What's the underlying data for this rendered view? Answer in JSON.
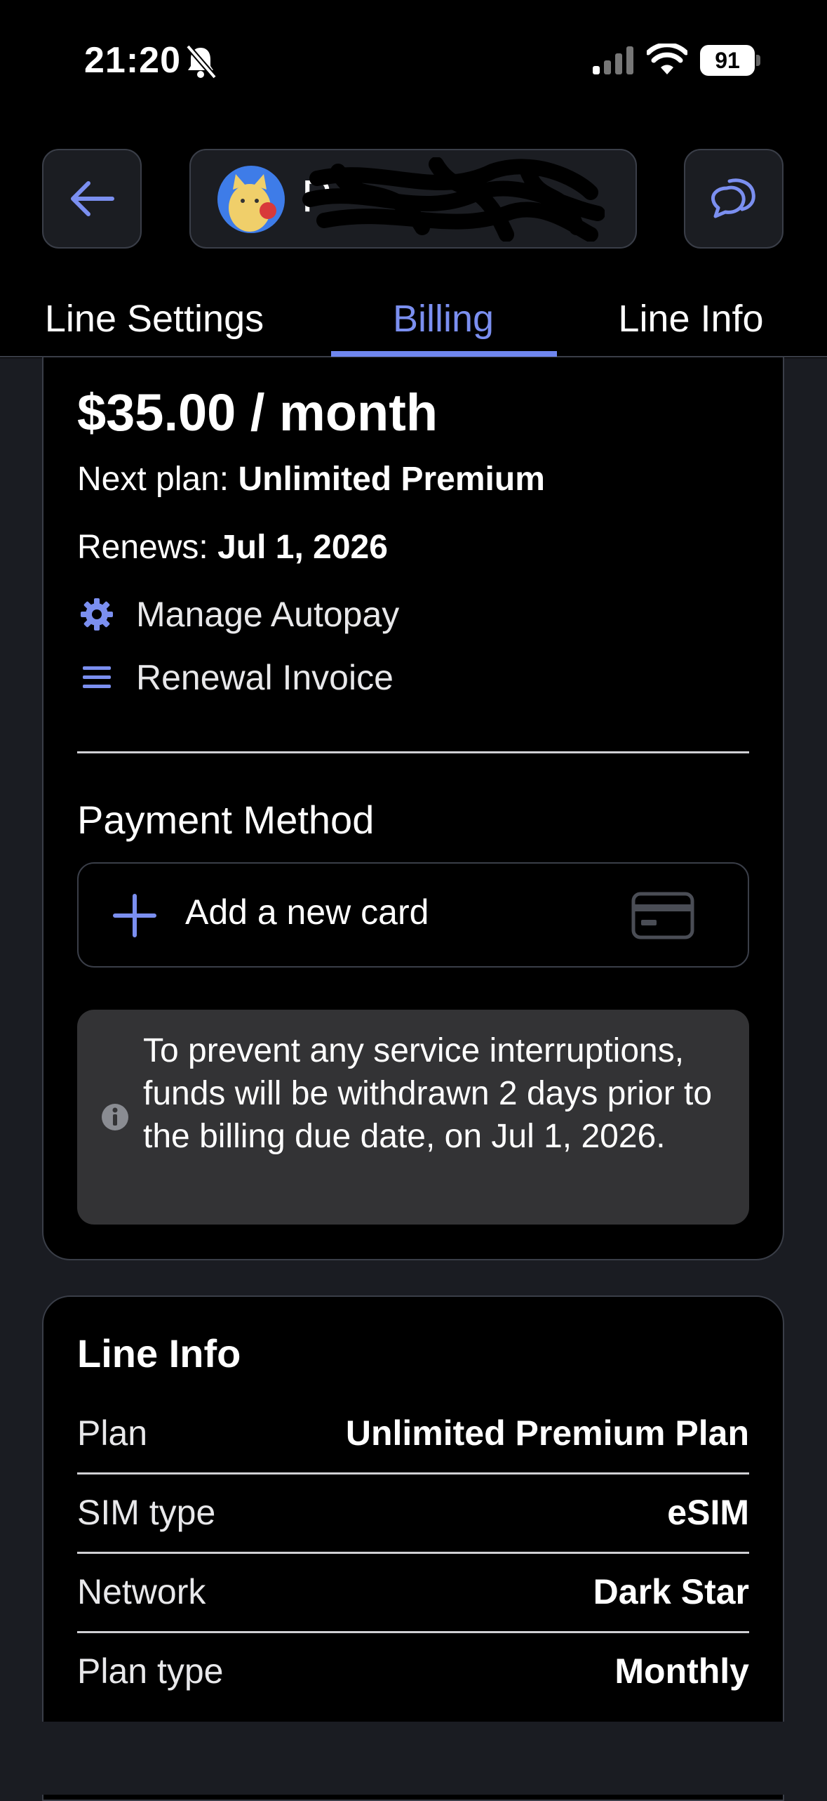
{
  "status_bar": {
    "time": "21:20",
    "battery": "91"
  },
  "header": {
    "account_name": "P"
  },
  "tabs": [
    {
      "label": "Line Settings",
      "active": false
    },
    {
      "label": "Billing",
      "active": true
    },
    {
      "label": "Line Info",
      "active": false
    }
  ],
  "billing": {
    "price": "$35.00 / month",
    "next_plan_label": "Next plan: ",
    "next_plan_value": "Unlimited Premium",
    "renews_label": "Renews: ",
    "renews_value": "Jul 1, 2026",
    "actions": [
      {
        "label": "Manage Autopay",
        "icon": "gear-icon"
      },
      {
        "label": "Renewal Invoice",
        "icon": "list-icon"
      }
    ],
    "payment_method_title": "Payment Method",
    "add_card_label": "Add a new card",
    "notice": "To prevent any service interruptions, funds will be withdrawn 2 days prior to the billing due date, on Jul 1, 2026."
  },
  "line_info": {
    "title": "Line Info",
    "rows": [
      {
        "key": "Plan",
        "value": "Unlimited Premium Plan"
      },
      {
        "key": "SIM type",
        "value": "eSIM"
      },
      {
        "key": "Network",
        "value": "Dark Star"
      },
      {
        "key": "Plan type",
        "value": "Monthly"
      }
    ]
  },
  "colors": {
    "accent": "#6f86ef",
    "background": "#1a1c22",
    "card": "#000000",
    "notice_bg": "#333335"
  }
}
